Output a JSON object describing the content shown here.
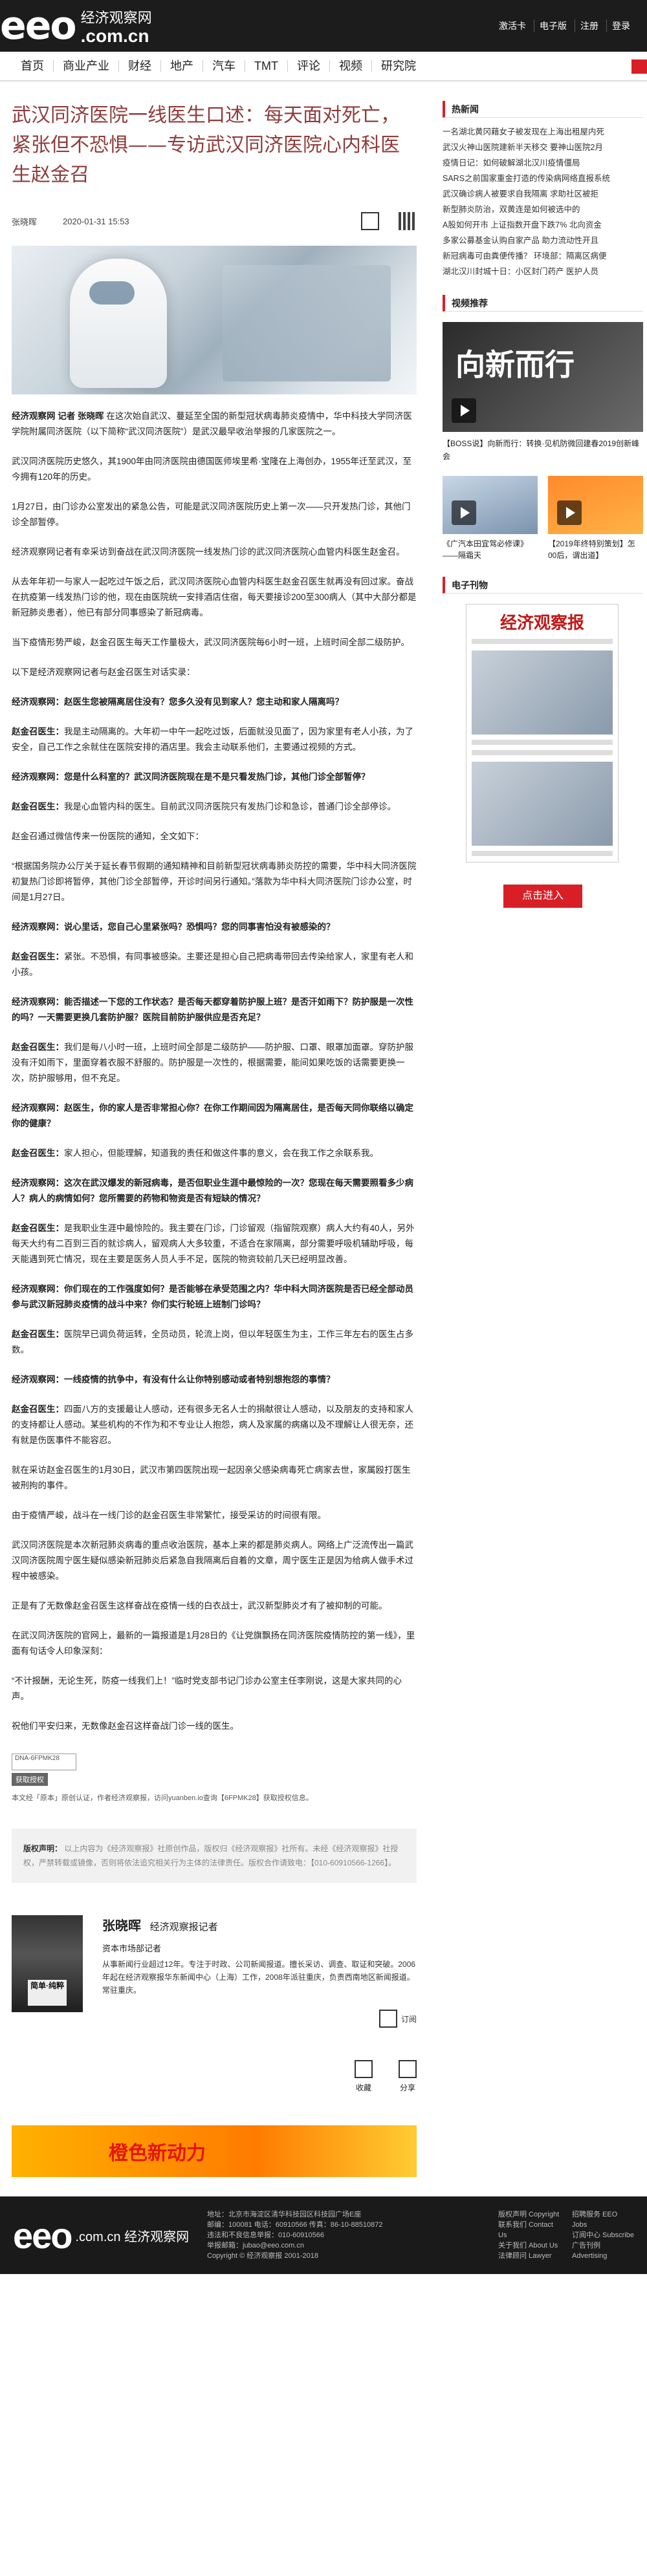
{
  "header": {
    "logo_mark": "eeo",
    "logo_cn": "经济观察网",
    "logo_domain": ".com.cn",
    "links": [
      "激活卡",
      "电子版",
      "注册",
      "登录"
    ]
  },
  "menu": [
    "首页",
    "商业产业",
    "财经",
    "地产",
    "汽车",
    "TMT",
    "评论",
    "视频",
    "研究院"
  ],
  "article": {
    "title": "武汉同济医院一线医生口述：每天面对死亡，紧张但不恐惧——专访武汉同济医院心内科医生赵金召",
    "author": "张晓晖",
    "time": "2020-01-31 15:53",
    "paragraphs": [
      [
        "经济观察网 记者 张晓晖",
        " 在这次始自武汉、蔓延至全国的新型冠状病毒肺炎疫情中，华中科技大学同济医学院附属同济医院（以下简称“武汉同济医院”）是武汉最早收治举报的几家医院之一。"
      ],
      [
        "",
        "武汉同济医院历史悠久，其1900年由同济医院由德国医师埃里希·宝隆在上海创办，1955年迁至武汉，至今拥有120年的历史。"
      ],
      [
        "",
        "1月27日，由门诊办公室发出的紧急公告，可能是武汉同济医院历史上第一次——只开发热门诊，其他门诊全部暂停。"
      ],
      [
        "",
        "经济观察网记者有幸采访到奋战在武汉同济医院一线发热门诊的武汉同济医院心血管内科医生赵金召。"
      ],
      [
        "",
        "从去年年初一与家人一起吃过午饭之后，武汉同济医院心血管内科医生赵金召医生就再没有回过家。奋战在抗疫第一线发热门诊的他，现在由医院统一安排酒店住宿，每天要接诊200至300病人（其中大部分都是新冠肺炎患者），他已有部分同事感染了新冠病毒。"
      ],
      [
        "",
        "当下疫情形势严峻，赵金召医生每天工作量极大，武汉同济医院每6小时一班，上班时间全部二级防护。"
      ],
      [
        "",
        "以下是经济观察网记者与赵金召医生对话实录："
      ],
      [
        "经济观察网：赵医生您被隔离居住没有？您多久没有见到家人？您主动和家人隔离吗？",
        ""
      ],
      [
        "赵金召医生：",
        "我是主动隔离的。大年初一中午一起吃过饭，后面就没见面了，因为家里有老人小孩，为了安全，自己工作之余就住在医院安排的酒店里。我会主动联系他们，主要通过视频的方式。"
      ],
      [
        "经济观察网：您是什么科室的？武汉同济医院现在是不是只看发热门诊，其他门诊全部暂停？",
        ""
      ],
      [
        "赵金召医生：",
        "我是心血管内科的医生。目前武汉同济医院只有发热门诊和急诊，普通门诊全部停诊。"
      ],
      [
        "",
        "赵金召通过微信传来一份医院的通知，全文如下："
      ],
      [
        "",
        "“根据国务院办公厅关于延长春节假期的通知精神和目前新型冠状病毒肺炎防控的需要，华中科大同济医院初复热门诊即将暂停，其他门诊全部暂停，开诊时间另行通知。”落款为华中科大同济医院门诊办公室，时间是1月27日。"
      ],
      [
        "经济观察网：说心里话，您自己心里紧张吗？恐惧吗？您的同事害怕没有被感染的？",
        ""
      ],
      [
        "赵金召医生：",
        "紧张。不恐惧，有同事被感染。主要还是担心自己把病毒带回去传染给家人，家里有老人和小孩。"
      ],
      [
        "经济观察网：能否描述一下您的工作状态？是否每天都穿着防护服上班？是否汗如雨下？防护服是一次性的吗？一天需要更换几套防护服？医院目前防护服供应是否充足？",
        ""
      ],
      [
        "赵金召医生：",
        "我们是每八小时一班，上班时间全部是二级防护——防护服、口罩、眼罩加面罩。穿防护服没有汗如雨下，里面穿着衣服不舒服的。防护服是一次性的，根据需要，能间如果吃饭的话需要更换一次，防护服够用，但不充足。"
      ],
      [
        "经济观察网：赵医生，你的家人是否非常担心你？在你工作期间因为隔离居住，是否每天同你联络以确定你的健康？",
        ""
      ],
      [
        "赵金召医生：",
        "家人担心，但能理解，知道我的责任和做这件事的意义，会在我工作之余联系我。"
      ],
      [
        "经济观察网：这次在武汉爆发的新冠病毒，是否但职业生涯中最惊险的一次？您现在每天需要照看多少病人？病人的病情如何？您所需要的药物和物资是否有短缺的情况？",
        ""
      ],
      [
        "赵金召医生：",
        "是我职业生涯中最惊险的。我主要在门诊，门诊留观（指留院观察）病人大约有40人，另外每天大约有二百到三百的就诊病人，留观病人大多较重，不适合在家隔离，部分需要呼吸机辅助呼吸，每天能遇到死亡情况，现在主要是医务人员人手不足，医院的物资较前几天已经明显改善。"
      ],
      [
        "经济观察网：你们现在的工作强度如何？是否能够在承受范围之内？华中科大同济医院是否已经全部动员参与武汉新冠肺炎疫情的战斗中来？你们实行轮班上班制门诊吗？",
        ""
      ],
      [
        "赵金召医生：",
        "医院早已调负荷运转，全员动员，轮流上岗，但以年轻医生为主，工作三年左右的医生占多数。"
      ],
      [
        "经济观察网：一线疫情的抗争中，有没有什么让你特别感动或者特别想抱怨的事情？",
        ""
      ],
      [
        "赵金召医生：",
        "四面八方的支援最让人感动，还有很多无名人士的捐献很让人感动，以及朋友的支持和家人的支持都让人感动。某些机构的不作为和不专业让人抱怨，病人及家属的病痛以及不理解让人很无奈，还有就是伤医事件不能容忍。"
      ],
      [
        "",
        "就在采访赵金召医生的1月30日，武汉市第四医院出现一起因亲父感染病毒死亡病家去世，家属殴打医生被刑拘的事件。"
      ],
      [
        "",
        "由于疫情严峻，战斗在一线门诊的赵金召医生非常繁忙，接受采访的时间很有限。"
      ],
      [
        "",
        "武汉同济医院是本次新冠肺炎病毒的重点收治医院，基本上来的都是肺炎病人。网络上广泛流传出一篇武汉同济医院周宁医生疑似感染新冠肺炎后紧急自我隔离后自着的文章，周宁医生正是因为给病人做手术过程中被感染。"
      ],
      [
        "",
        "正是有了无数像赵金召医生这样奋战在疫情一线的白衣战士，武汉新型肺炎才有了被抑制的可能。"
      ],
      [
        "",
        "在武汉同济医院的官网上，最新的一篇报道是1月28日的《让党旗飘扬在同济医院疫情防控的第一线》，里面有句话令人印象深刻："
      ],
      [
        "",
        "“不计报酬，无论生死，防疫一线我们上！”临时党支部书记门诊办公室主任李刚说，这是大家共同的心声。"
      ],
      [
        "",
        "祝他们平安归来，无数像赵金召这样奋战门诊一线的医生。"
      ]
    ]
  },
  "tags": {
    "code": "DNA-6FPMK28",
    "btn": "获取授权",
    "note": "本文经「原本」原创认证，作者经济观察报，访问yuanben.io查询【6FPMK28】获取授权信息。"
  },
  "copyright": {
    "label": "版权声明：",
    "text": "以上内容为《经济观察报》社原创作品，版权归《经济观察报》社所有。未经《经济观察报》社授权，严禁转载或镜像，否则将依法追究相关行为主体的法律责任。版权合作请致电：【010-60910566-1266】。"
  },
  "reporter": {
    "name": "张晓晖",
    "role": "经济观察报记者",
    "shirt": "简单·纯粹",
    "desk": "资本市场部记者",
    "bio": "从事新闻行业超过12年。专注于时政、公司新闻报道。擅长采访、调查、取证和突破。2006年起在经济观察报华东新闻中心（上海）工作，2008年派驻重庆，负责西南地区新闻报道。常驻重庆。",
    "follow": "订阅",
    "fav": "收藏",
    "share": "分享"
  },
  "banner": {
    "text": "橙色新动力"
  },
  "sidebar": {
    "hot_title": "热新闻",
    "hot_items": [
      "一名湖北黄冈藉女子被发现在上海出租屋内死",
      "武汉火神山医院建新半天移交 要神山医院2月",
      "疫情日记：如何破解湖北汉川疫情僵局",
      "SARS之前国家重金打造的传染病网络直报系统",
      "武汉确诊病人被要求自我隔离 求助社区被拒",
      "新型肺炎防治，双黄连是如何被选中的",
      "A股如何开市 上证指数开盘下跌7% 北向资金",
      "多家公募基金认购自家产品 助力流动性开且",
      "新冠病毒可由粪便传播？ 环境部：隔离区病便",
      "湖北汉川封城十日：小区封门药产 医护人员"
    ],
    "video_title": "视频推荐",
    "video_main_text": "向新而行",
    "video_main_cap": "【BOSS说】向新而行：转换·见机防微回建春2019创新峰会",
    "vids": [
      {
        "cap": "《广汽本田宜驾必修课》——隔霜天"
      },
      {
        "cap": "【2019年终特别策划】怎00后，谓出道】"
      }
    ],
    "paper_title": "电子刊物",
    "paper_head": "经济观察报",
    "enter": "点击进入"
  },
  "footer": {
    "logo_mark": "eeo",
    "logo_cn": ".com.cn 经济观察网",
    "lines": [
      "地址：北京市海淀区清华科技园区科技园广场E座",
      "邮编：100081 电话：60910566 传真：86-10-88510872",
      "违法和不良信息举报：010-60910566",
      "举报邮箱：jubao@eeo.com.cn",
      "Copyright © 经济观察报 2001-2018"
    ],
    "right_a": [
      "版权声明 Copyright",
      "联系我们 Contact Us",
      "关于我们 About Us",
      "法律顾问 Lawyer"
    ],
    "right_b": [
      "招聘服务 EEO Jobs",
      "订阅中心 Subscribe",
      "广告刊例 Advertising"
    ]
  }
}
